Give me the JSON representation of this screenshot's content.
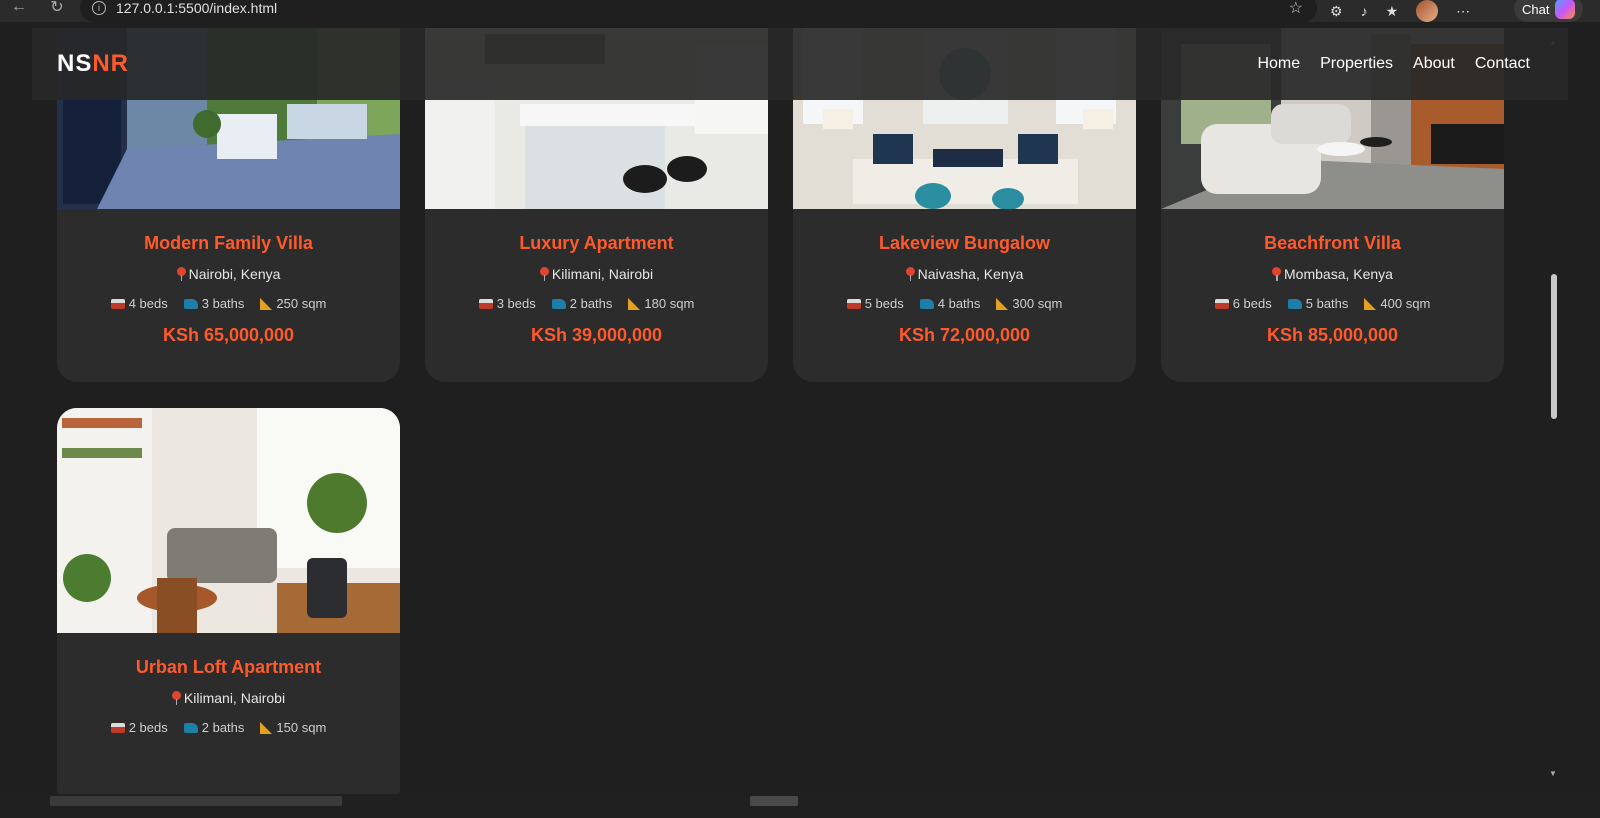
{
  "browser": {
    "url": "127.0.0.1:5500/index.html",
    "chat_label": "Chat"
  },
  "site": {
    "logo_part1": "NS",
    "logo_part2": "NR",
    "nav": [
      "Home",
      "Properties",
      "About",
      "Contact"
    ]
  },
  "properties": [
    {
      "title": "Modern Family Villa",
      "location": "Nairobi, Kenya",
      "beds": "4 beds",
      "baths": "3 baths",
      "area": "250 sqm",
      "price": "KSh 65,000,000",
      "image": "porch-photo"
    },
    {
      "title": "Luxury Apartment",
      "location": "Kilimani, Nairobi",
      "beds": "3 beds",
      "baths": "2 baths",
      "area": "180 sqm",
      "price": "KSh 39,000,000",
      "image": "kitchen-photo"
    },
    {
      "title": "Lakeview Bungalow",
      "location": "Naivasha, Kenya",
      "beds": "5 beds",
      "baths": "4 baths",
      "area": "300 sqm",
      "price": "KSh 72,000,000",
      "image": "living-room-photo"
    },
    {
      "title": "Beachfront Villa",
      "location": "Mombasa, Kenya",
      "beds": "6 beds",
      "baths": "5 baths",
      "area": "400 sqm",
      "price": "KSh 85,000,000",
      "image": "open-plan-photo"
    },
    {
      "title": "Urban Loft Apartment",
      "location": "Kilimani, Nairobi",
      "beds": "2 beds",
      "baths": "2 baths",
      "area": "150 sqm",
      "price": "",
      "image": "loft-photo"
    }
  ],
  "colors": {
    "accent": "#ff5a2c",
    "card": "#2c2c2c",
    "background": "#1f1f1f"
  }
}
